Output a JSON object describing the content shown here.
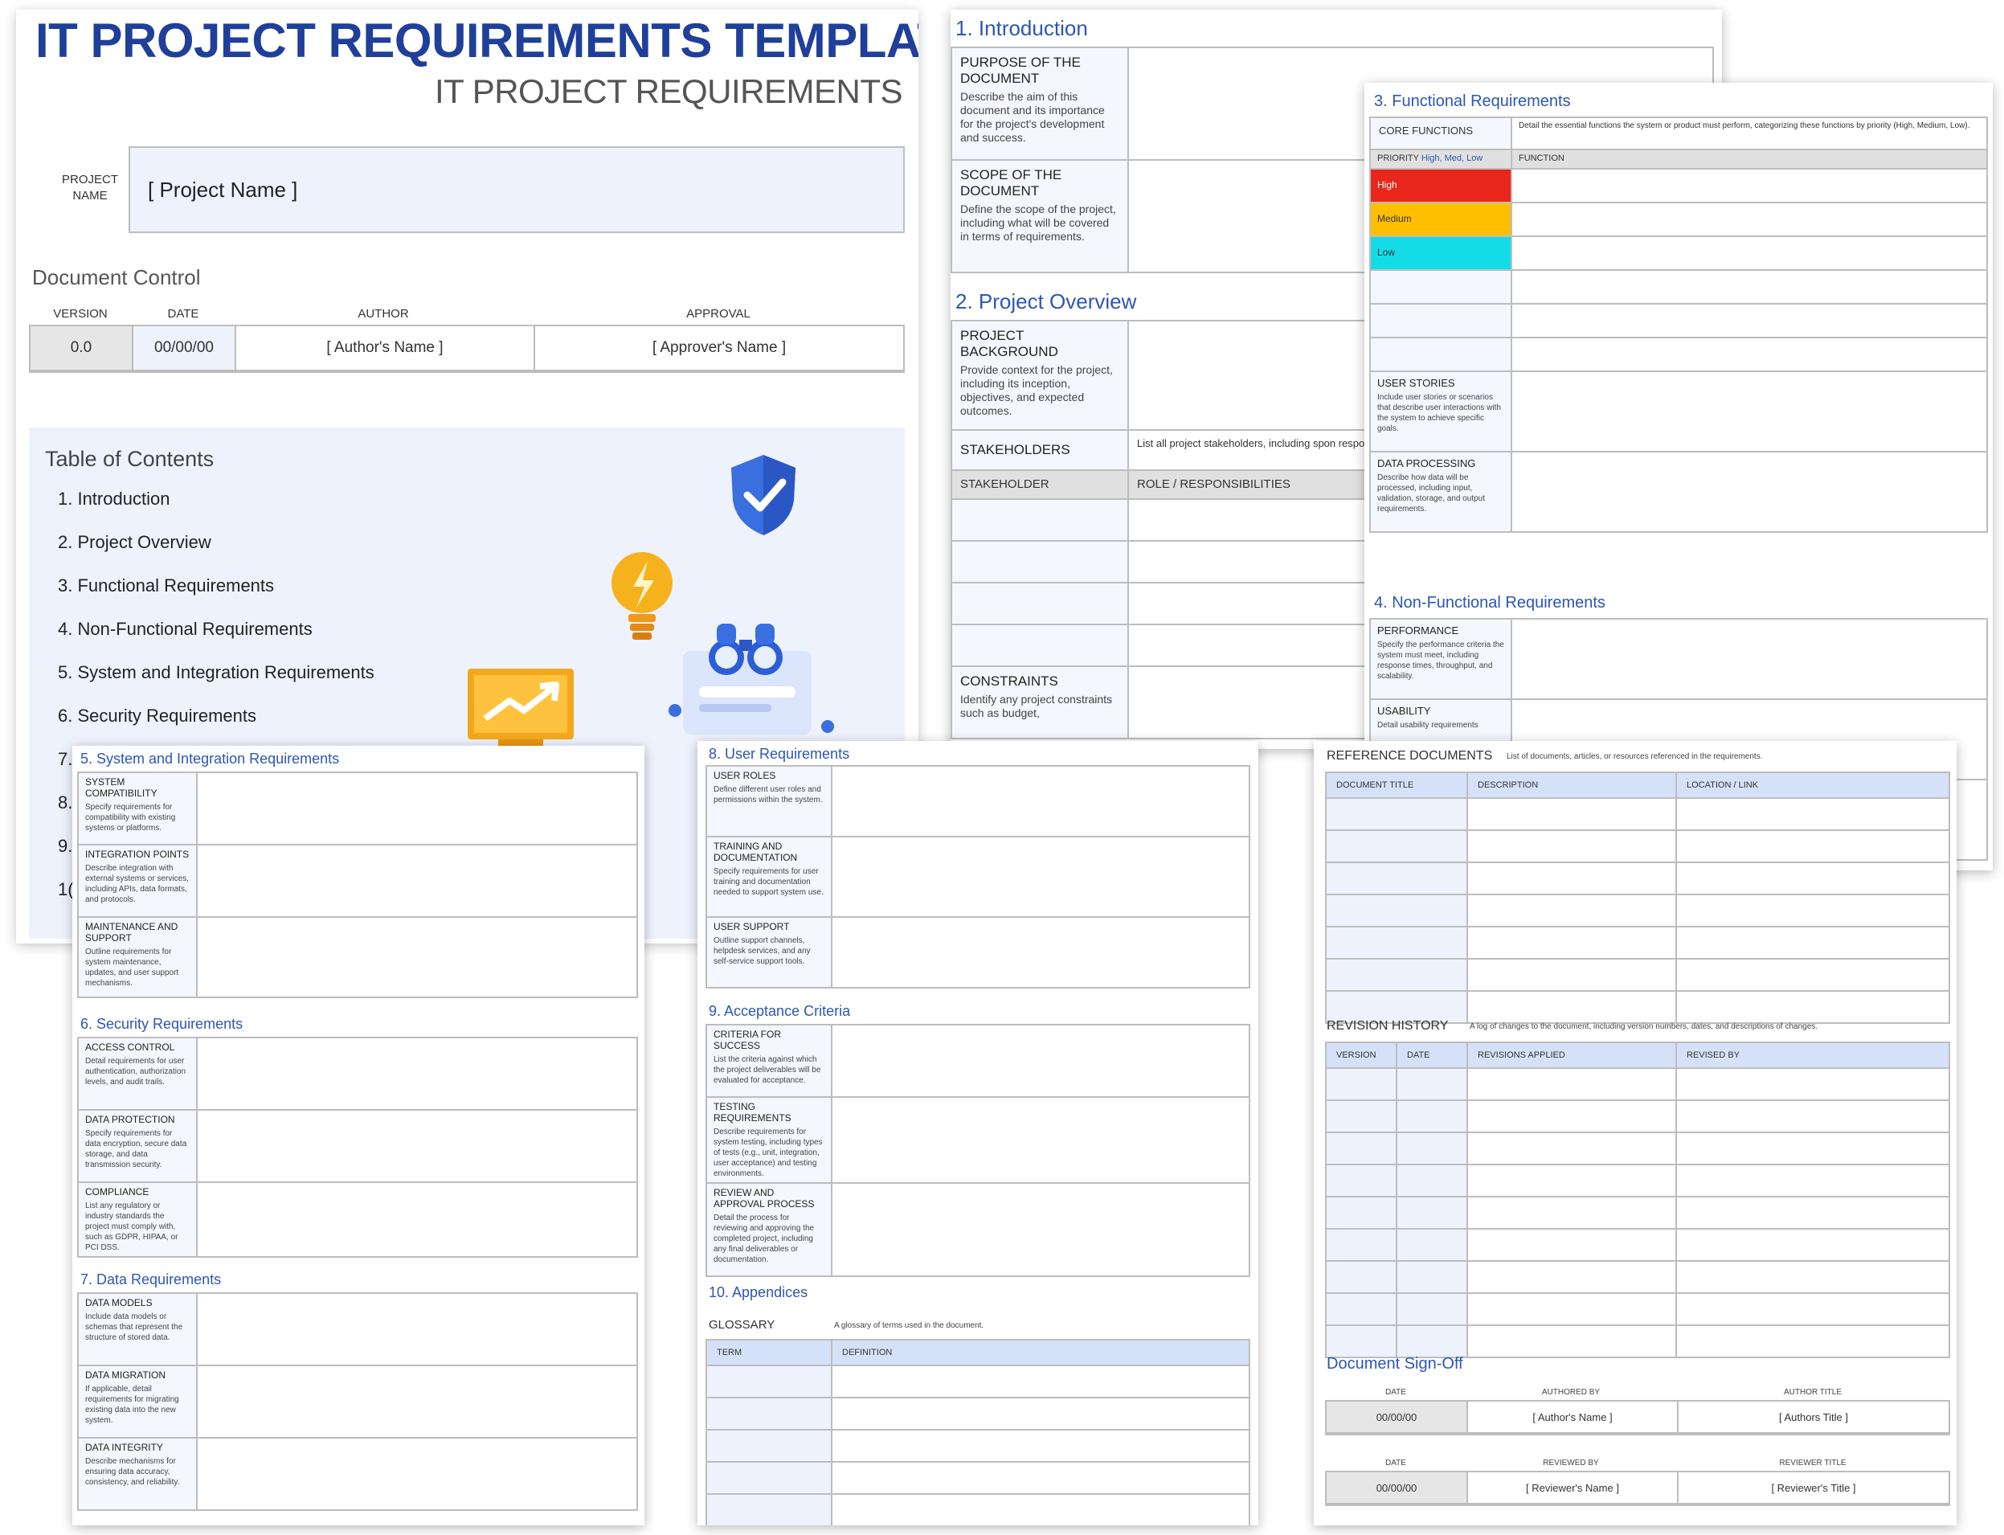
{
  "cover": {
    "main_title": "IT PROJECT REQUIREMENTS TEMPLATE",
    "subtitle": "IT PROJECT REQUIREMENTS",
    "project_name_label": "PROJECT NAME",
    "project_name_value": "[ Project Name ]",
    "doc_control_title": "Document Control",
    "doc_control_headers": [
      "VERSION",
      "DATE",
      "AUTHOR",
      "APPROVAL"
    ],
    "doc_control_row": [
      "0.0",
      "00/00/00",
      "[ Author's Name ]",
      "[ Approver's Name ]"
    ],
    "toc_title": "Table of Contents",
    "toc_items": [
      "1. Introduction",
      "2. Project Overview",
      "3. Functional Requirements",
      "4. Non-Functional Requirements",
      "5. System and Integration Requirements",
      "6. Security Requirements",
      "7.",
      "8.",
      "9.",
      "1("
    ]
  },
  "intro_page": {
    "intro_title": "1. Introduction",
    "purpose_label": "PURPOSE OF THE DOCUMENT",
    "purpose_desc": "Describe the aim of this document and its importance for the project's development and success.",
    "scope_label": "SCOPE OF THE DOCUMENT",
    "scope_desc": "Define the scope of the project, including what will be covered in terms of requirements.",
    "overview_title": "2. Project Overview",
    "background_label": "PROJECT BACKGROUND",
    "background_desc": "Provide context for the project, including its inception, objectives, and expected outcomes.",
    "stakeholders_label": "STAKEHOLDERS",
    "stakeholders_desc": "List all project stakeholders, including spon responsibilities.",
    "stakeholder_head": "STAKEHOLDER",
    "role_head": "ROLE / RESPONSIBILITIES",
    "constraints_label": "CONSTRAINTS",
    "constraints_desc": "Identify any project constraints such as budget,"
  },
  "functional_page": {
    "title": "3. Functional Requirements",
    "core_label": "CORE FUNCTIONS",
    "core_desc": "Detail the essential functions the system or product must perform, categorizing these functions by priority (High, Medium, Low).",
    "priority_head": "PRIORITY",
    "priority_hint": "High, Med, Low",
    "function_head": "FUNCTION",
    "priorities": [
      "High",
      "Medium",
      "Low"
    ],
    "priority_colors": [
      "#e8261c",
      "#ffbf00",
      "#14dce6"
    ],
    "user_stories_label": "USER STORIES",
    "user_stories_desc": "Include user stories or scenarios that describe user interactions with the system to achieve specific goals.",
    "data_processing_label": "DATA PROCESSING",
    "data_processing_desc": "Describe how data will be processed, including input, validation, storage, and output requirements.",
    "nonfunctional_title": "4. Non-Functional Requirements",
    "performance_label": "PERFORMANCE",
    "performance_desc": "Specify the performance criteria the system must meet, including response times, throughput, and scalability.",
    "usability_label": "USABILITY",
    "usability_desc": "Detail usability requirements"
  },
  "system_page": {
    "sys_title": "5. System and Integration Requirements",
    "sys_rows": [
      {
        "label": "SYSTEM COMPATIBILITY",
        "desc": "Specify requirements for compatibility with existing systems or platforms."
      },
      {
        "label": "INTEGRATION POINTS",
        "desc": "Describe integration with external systems or services, including APIs, data formats, and protocols."
      },
      {
        "label": "MAINTENANCE AND SUPPORT",
        "desc": "Outline requirements for system maintenance, updates, and user support mechanisms."
      }
    ],
    "sec_title": "6. Security Requirements",
    "sec_rows": [
      {
        "label": "ACCESS CONTROL",
        "desc": "Detail requirements for user authentication, authorization levels, and audit trails."
      },
      {
        "label": "DATA PROTECTION",
        "desc": "Specify requirements for data encryption, secure data storage, and data transmission security."
      },
      {
        "label": "COMPLIANCE",
        "desc": "List any regulatory or industry standards the project must comply with, such as GDPR, HIPAA, or PCI DSS."
      }
    ],
    "data_title": "7. Data Requirements",
    "data_rows": [
      {
        "label": "DATA MODELS",
        "desc": "Include data models or schemas that represent the structure of stored data."
      },
      {
        "label": "DATA MIGRATION",
        "desc": "If applicable, detail requirements for migrating existing data into the new system."
      },
      {
        "label": "DATA INTEGRITY",
        "desc": "Describe mechanisms for ensuring data accuracy, consistency, and reliability."
      }
    ]
  },
  "user_page": {
    "user_title": "8. User Requirements",
    "user_rows": [
      {
        "label": "USER ROLES",
        "desc": "Define different user roles and permissions within the system."
      },
      {
        "label": "TRAINING AND DOCUMENTATION",
        "desc": "Specify requirements for user training and documentation needed to support system use."
      },
      {
        "label": "USER SUPPORT",
        "desc": "Outline support channels, helpdesk services, and any self-service support tools."
      }
    ],
    "accept_title": "9. Acceptance Criteria",
    "accept_rows": [
      {
        "label": "CRITERIA FOR SUCCESS",
        "desc": "List the criteria against which the project deliverables will be evaluated for acceptance."
      },
      {
        "label": "TESTING REQUIREMENTS",
        "desc": "Describe requirements for system testing, including types of tests (e.g., unit, integration, user acceptance) and testing environments."
      },
      {
        "label": "REVIEW AND APPROVAL PROCESS",
        "desc": "Detail the process for reviewing and approving the completed project, including any final deliverables or documentation."
      }
    ],
    "appendices_title": "10. Appendices",
    "glossary_label": "GLOSSARY",
    "glossary_desc": "A glossary of terms used in the document.",
    "glossary_headers": [
      "TERM",
      "DEFINITION"
    ]
  },
  "reference_page": {
    "ref_label": "REFERENCE DOCUMENTS",
    "ref_desc": "List of documents, articles, or resources referenced in the requirements.",
    "ref_headers": [
      "DOCUMENT TITLE",
      "DESCRIPTION",
      "LOCATION / LINK"
    ],
    "rev_label": "REVISION HISTORY",
    "rev_desc": "A log of changes to the document, including version numbers, dates, and descriptions of changes.",
    "rev_headers": [
      "VERSION",
      "DATE",
      "REVISIONS APPLIED",
      "REVISED BY"
    ],
    "signoff_title": "Document Sign-Off",
    "sign_headers_1": [
      "DATE",
      "AUTHORED BY",
      "AUTHOR TITLE"
    ],
    "sign_row_1": [
      "00/00/00",
      "[ Author's Name ]",
      "[ Authors Title ]"
    ],
    "sign_headers_2": [
      "DATE",
      "REVIEWED BY",
      "REVIEWER TITLE"
    ],
    "sign_row_2": [
      "00/00/00",
      "[ Reviewer's Name ]",
      "[ Reviewer's Title ]"
    ]
  }
}
